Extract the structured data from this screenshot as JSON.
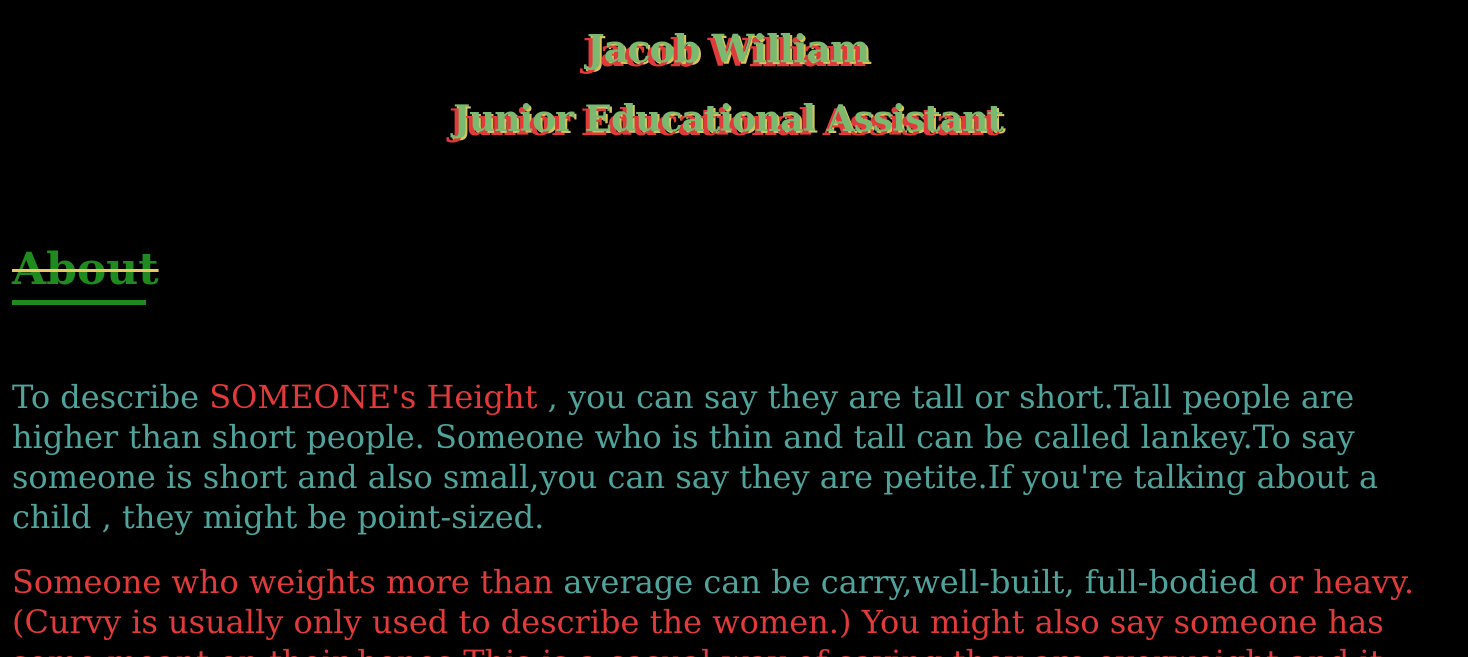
{
  "header": {
    "name": "Jacob William",
    "job_title": "Junior Educational Assistant"
  },
  "about": {
    "heading": "About",
    "paragraph1": {
      "part1": "To describe ",
      "part2": "SOMEONE's Height",
      "part3": " , you can say they are tall or short.Tall people are higher than short people. Someone who is thin and tall can be called lankey.To say someone is short and also small,you can say they are petite.If you're talking about a child , they might be point-sized."
    },
    "paragraph2": {
      "part1": "Someone who weights more than",
      "part2": " average can be carry,well-built, full-bodied",
      "part3": " or heavy. (Curvy is usually only used to describe the women.) You might also say someone has some meant on their bones.This is a casual way of saying they are overweight and it"
    }
  },
  "colors": {
    "background": "#000000",
    "name_fill": "#7bb870",
    "shadow_red": "#e03a3a",
    "shadow_yellow": "#d8c35a",
    "heading_green": "#1f8a1f",
    "body_teal": "#4fa39a",
    "body_red": "#e03a3a"
  }
}
